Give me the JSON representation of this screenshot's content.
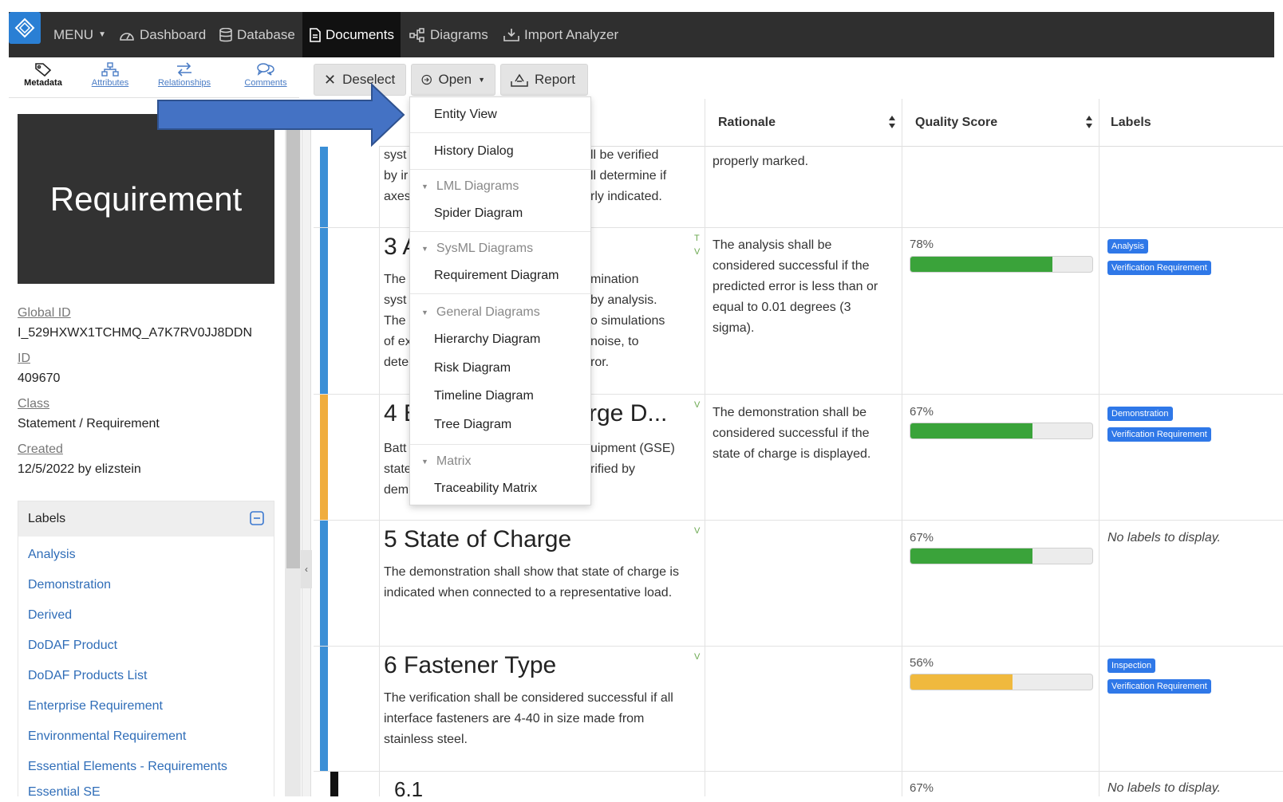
{
  "nav": {
    "menu": "MENU",
    "items": [
      "Dashboard",
      "Database",
      "Documents",
      "Diagrams",
      "Import Analyzer"
    ],
    "active": "Documents"
  },
  "left_tabs": [
    "Metadata",
    "Attributes",
    "Relationships",
    "Comments"
  ],
  "entity": {
    "class_title": "Requirement",
    "global_id_label": "Global ID",
    "global_id": "I_529HXWX1TCHMQ_A7K7RV0JJ8DDN",
    "id_label": "ID",
    "id": "409670",
    "class_label": "Class",
    "class": "Statement / Requirement",
    "created_label": "Created",
    "created": "12/5/2022 by elizstein"
  },
  "labels_panel": {
    "title": "Labels",
    "items": [
      "Analysis",
      "Demonstration",
      "Derived",
      "DoDAF Product",
      "DoDAF Products List",
      "Enterprise Requirement",
      "Environmental Requirement",
      "Essential Elements - Requirements",
      "Essential SE"
    ]
  },
  "toolbar": {
    "deselect": "Deselect",
    "open": "Open",
    "report": "Report"
  },
  "open_menu": {
    "items": [
      "Entity View",
      "History Dialog"
    ],
    "groups": [
      {
        "heading": "LML Diagrams",
        "items": [
          "Spider Diagram"
        ]
      },
      {
        "heading": "SysML Diagrams",
        "items": [
          "Requirement Diagram"
        ]
      },
      {
        "heading": "General Diagrams",
        "items": [
          "Hierarchy Diagram",
          "Risk Diagram",
          "Timeline Diagram",
          "Tree Diagram"
        ]
      },
      {
        "heading": "Matrix",
        "items": [
          "Traceability Matrix"
        ]
      }
    ]
  },
  "table": {
    "columns": [
      "Rationale",
      "Quality Score",
      "Labels"
    ],
    "no_labels": "No labels to display.",
    "rows": [
      {
        "desc_lines": [
          "syst",
          "by ir",
          "axes"
        ],
        "desc_right": [
          "ll be verified",
          "ll determine if",
          "rly indicated."
        ],
        "rationale": "properly marked.",
        "color": "#3b8fd6"
      },
      {
        "title": "3 A",
        "flag_top": "T",
        "flag_bottom": "V",
        "desc_lines": [
          "The",
          "syst",
          "The",
          "of ex",
          "dete"
        ],
        "desc_right": [
          "mination",
          "by analysis.",
          "o simulations",
          "noise, to",
          "ror."
        ],
        "rationale": "The analysis shall be considered successful if the predicted error is less than or equal to 0.01 degrees (3 sigma).",
        "score": "78%",
        "score_value": 78,
        "labels": [
          "Analysis",
          "Verification Requirement"
        ],
        "color": "#3b8fd6",
        "bar_color": "#3aa33a"
      },
      {
        "title_left": "4 E",
        "title_right": "rge D...",
        "flag": "V",
        "desc_lines": [
          "Batt",
          "state",
          "dem"
        ],
        "desc_right": [
          "uipment (GSE)",
          "rified by"
        ],
        "rationale": "The demonstration shall be considered successful if the state of charge is displayed.",
        "score": "67%",
        "score_value": 67,
        "labels": [
          "Demonstration",
          "Verification Requirement"
        ],
        "color": "#f0ad3e",
        "bar_color": "#3aa33a"
      },
      {
        "title": "5 State of Charge",
        "flag": "V",
        "desc": "The demonstration shall show that state of charge is indicated when connected to a representative load.",
        "score": "67%",
        "score_value": 67,
        "color": "#3b8fd6",
        "bar_color": "#3aa33a"
      },
      {
        "title": "6 Fastener Type",
        "flag": "V",
        "desc": "The verification shall be considered successful if all interface fasteners are 4-40 in size made from stainless steel.",
        "score": "56%",
        "score_value": 56,
        "labels": [
          "Inspection",
          "Verification Requirement"
        ],
        "color": "#3b8fd6",
        "bar_color": "#f0b93e"
      },
      {
        "title": "6.1",
        "score": "67%",
        "color": "#111111"
      }
    ]
  },
  "colors": {
    "nav_bg": "#2f2f2f",
    "accent": "#2f78e8",
    "arrow": "#4472c4"
  }
}
